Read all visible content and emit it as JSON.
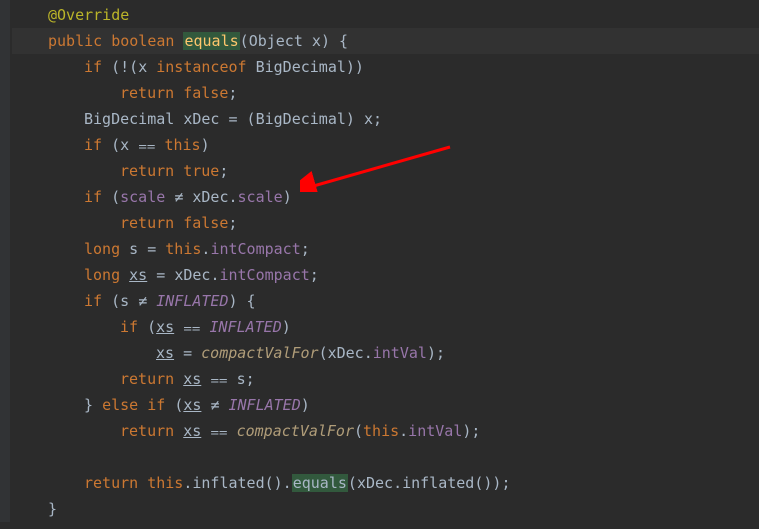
{
  "code": {
    "annotation": "@Override",
    "kw_public": "public",
    "kw_boolean": "boolean",
    "method_name": "equals",
    "param_type": "Object",
    "param_name": "x",
    "open_brace": " {",
    "l1_if": "if",
    "l1_instanceof": "instanceof",
    "l1_bigdecimal": "BigDecimal",
    "kw_return": "return",
    "kw_false": "false",
    "kw_true": "true",
    "kw_this": "this",
    "kw_long": "long",
    "kw_else": "else",
    "type_bigdecimal": "BigDecimal",
    "var_xdec": "xDec",
    "var_s": "s",
    "var_xs": "xs",
    "field_scale": "scale",
    "field_intcompact": "intCompact",
    "field_intval": "intVal",
    "const_inflated": "INFLATED",
    "fn_compactvalfor": "compactValFor",
    "fn_inflated": "inflated",
    "fn_equals": "equals",
    "semi": ";",
    "close_brace": "}",
    "op_eq": "==",
    "op_ne": "≠",
    "op_eqeq_lig": "⩵",
    "op_assign": "="
  },
  "annotations": {
    "arrow_color": "#ff0000"
  }
}
